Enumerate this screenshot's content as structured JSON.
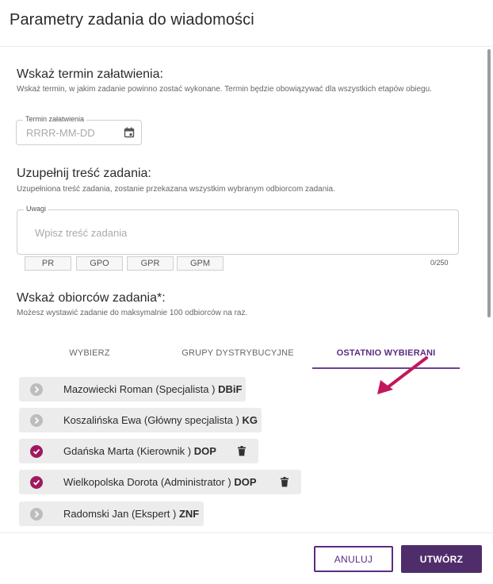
{
  "dialog": {
    "title": "Parametry zadania do wiadomości"
  },
  "deadline": {
    "heading": "Wskaż termin załatwienia:",
    "description": "Wskaż termin, w jakim zadanie powinno zostać wykonane. Termin będzie obowiązywać dla wszystkich etapów obiegu.",
    "field_label": "Termin załatwienia",
    "placeholder": "RRRR-MM-DD",
    "icon": "calendar-icon"
  },
  "content": {
    "heading": "Uzupełnij treść zadania:",
    "description": "Uzupełniona treść zadania, zostanie przekazana wszystkim wybranym odbiorcom zadania.",
    "field_label": "Uwagi",
    "placeholder": "Wpisz treść zadania",
    "chips": [
      "PR",
      "GPO",
      "GPR",
      "GPM"
    ],
    "counter": "0/250"
  },
  "recipients": {
    "heading": "Wskaż obiorców zadania*:",
    "description": "Możesz wystawić zadanie do maksymalnie 100 odbiorców na raz.",
    "tabs": [
      "WYBIERZ",
      "GRUPY DYSTRYBUCYJNE",
      "OSTATNIO WYBIERANI"
    ],
    "active_tab": "OSTATNIO WYBIERANI",
    "people": [
      {
        "name": "Mazowiecki Roman (Specjalista )",
        "unit": "DBiF",
        "selected": false
      },
      {
        "name": "Koszalińska Ewa (Główny specjalista )",
        "unit": "KG",
        "selected": false
      },
      {
        "name": "Gdańska Marta (Kierownik )",
        "unit": "DOP",
        "selected": true
      },
      {
        "name": "Wielkopolska Dorota (Administrator )",
        "unit": "DOP",
        "selected": true
      },
      {
        "name": "Radomski Jan (Ekspert )",
        "unit": "ZNF",
        "selected": false
      }
    ]
  },
  "footer": {
    "cancel_label": "ANULUJ",
    "create_label": "UTWÓRZ"
  },
  "colors": {
    "accent": "#5b2c83",
    "primary_button": "#4f2d6b",
    "selected_icon": "#a0195f",
    "arrow": "#c2185b"
  }
}
